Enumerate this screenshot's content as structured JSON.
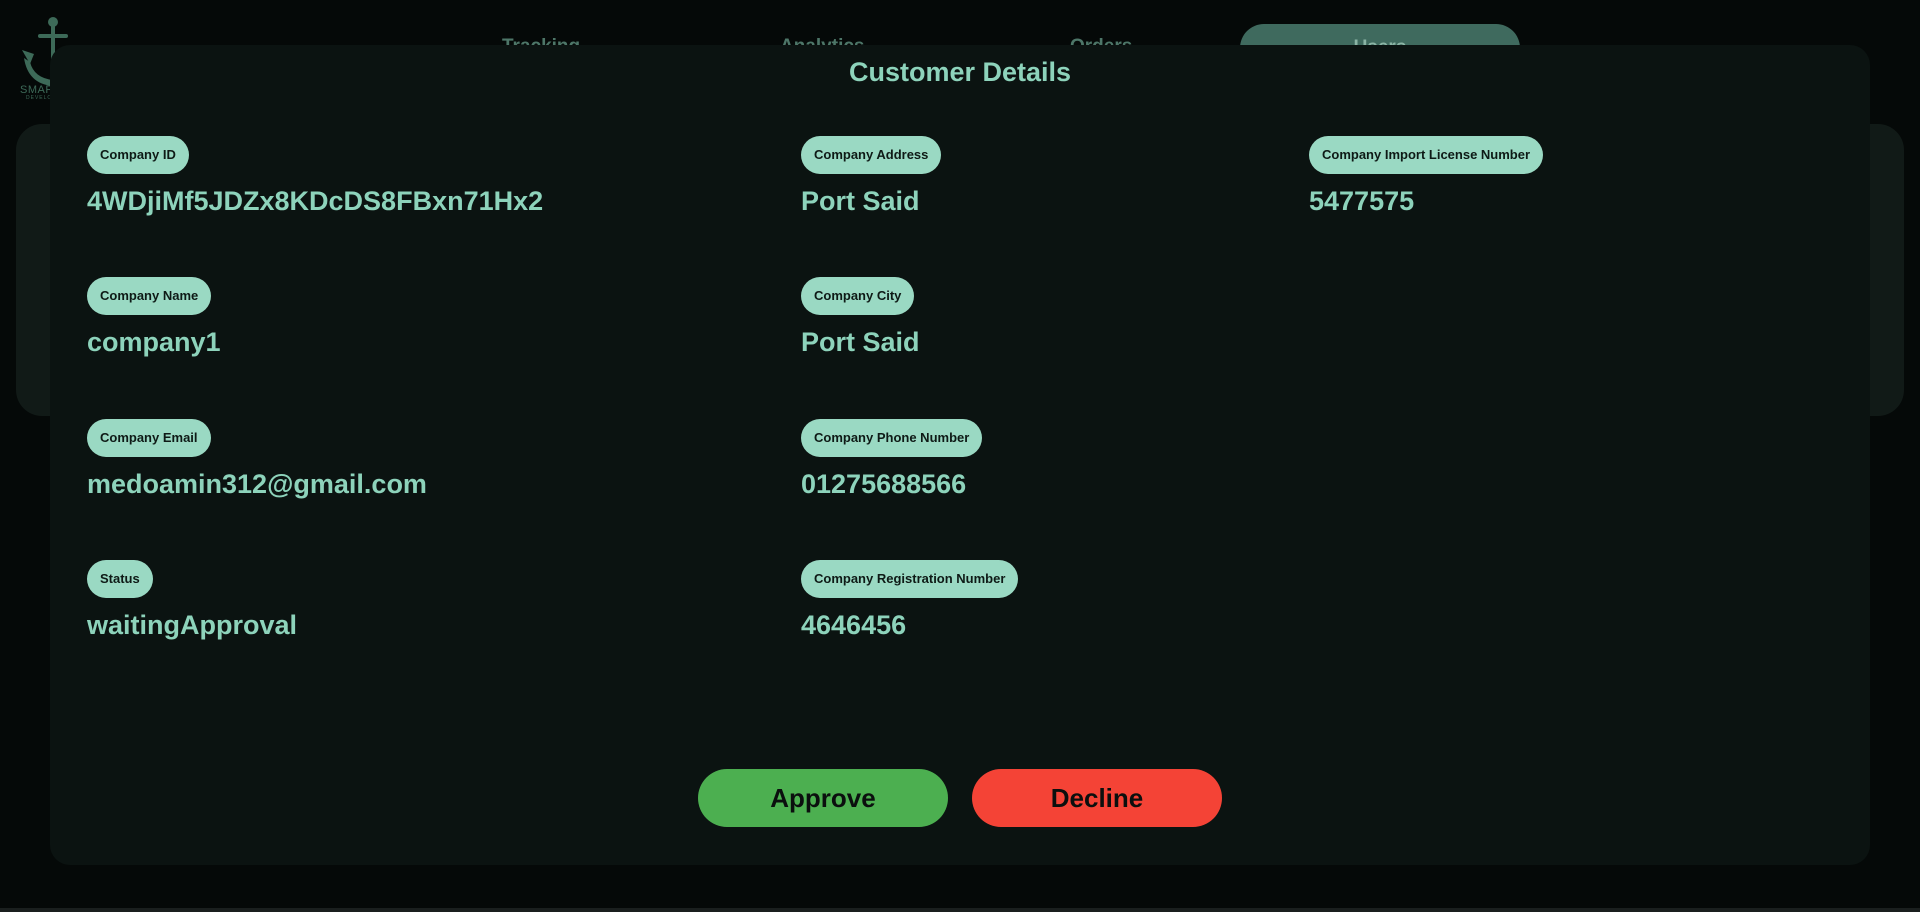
{
  "app": {
    "logo_text": "SMAR",
    "logo_subtext": "DEVELO"
  },
  "nav": {
    "items": [
      {
        "label": "Tracking"
      },
      {
        "label": "Analytics"
      },
      {
        "label": "Orders"
      },
      {
        "label": "Users"
      }
    ],
    "active": "Users"
  },
  "modal": {
    "title": "Customer Details",
    "fields": {
      "company_id": {
        "label": "Company ID",
        "value": "4WDjiMf5JDZx8KDcDS8FBxn71Hx2"
      },
      "company_name": {
        "label": "Company Name",
        "value": "company1"
      },
      "company_email": {
        "label": "Company Email",
        "value": "medoamin312@gmail.com"
      },
      "status": {
        "label": "Status",
        "value": "waitingApproval"
      },
      "company_address": {
        "label": "Company Address",
        "value": "Port Said"
      },
      "company_city": {
        "label": "Company City",
        "value": "Port Said"
      },
      "company_phone": {
        "label": "Company Phone Number",
        "value": "01275688566"
      },
      "company_registration": {
        "label": "Company Registration Number",
        "value": "4646456"
      },
      "company_import_license": {
        "label": "Company Import License Number",
        "value": "5477575"
      }
    },
    "actions": {
      "approve_label": "Approve",
      "decline_label": "Decline"
    }
  },
  "colors": {
    "accent": "#8dd3bb",
    "label_bg": "#9ad9c3",
    "approve": "#4caf50",
    "decline": "#f44336",
    "modal_bg": "#0b1311"
  }
}
